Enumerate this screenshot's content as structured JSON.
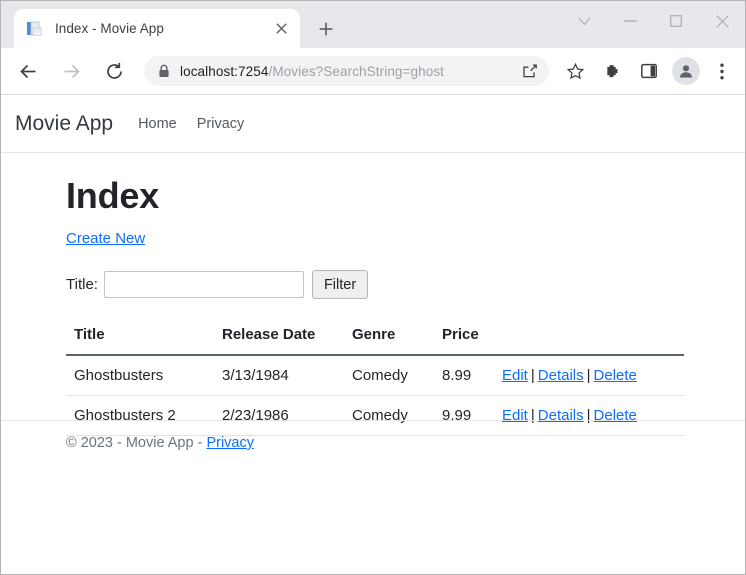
{
  "browser": {
    "tab": {
      "title": "Index - Movie App",
      "favicon": "document-icon",
      "close_label": "×"
    },
    "new_tab_label": "+",
    "window_controls": {
      "tab_search": "tab-search-icon",
      "minimize": "minimize-icon",
      "maximize": "maximize-icon",
      "close": "close-icon"
    },
    "nav": {
      "back": "back-icon",
      "forward": "forward-icon",
      "reload": "reload-icon"
    },
    "omnibox": {
      "security_icon": "lock-icon",
      "url_host": "localhost:7254",
      "url_path": "/Movies?SearchString=ghost",
      "full_url": "localhost:7254/Movies?SearchString=ghost",
      "share_icon": "share-icon",
      "bookmark_icon": "star-icon"
    },
    "toolbar_right": {
      "extensions": "puzzle-icon",
      "side_panel": "side-panel-icon",
      "profile": "avatar-icon",
      "menu": "three-dot-menu-icon"
    }
  },
  "site": {
    "brand": "Movie App",
    "nav_links": [
      {
        "label": "Home"
      },
      {
        "label": "Privacy"
      }
    ]
  },
  "main": {
    "heading": "Index",
    "create_new_label": "Create New",
    "filter": {
      "label": "Title:",
      "value": "",
      "placeholder": "",
      "button_label": "Filter"
    },
    "table": {
      "columns": [
        "Title",
        "Release Date",
        "Genre",
        "Price",
        ""
      ],
      "rows": [
        {
          "title": "Ghostbusters",
          "release_date": "3/13/1984",
          "genre": "Comedy",
          "price": "8.99",
          "actions": [
            "Edit",
            "Details",
            "Delete"
          ]
        },
        {
          "title": "Ghostbusters 2",
          "release_date": "2/23/1986",
          "genre": "Comedy",
          "price": "9.99",
          "actions": [
            "Edit",
            "Details",
            "Delete"
          ]
        }
      ],
      "action_separator": "|"
    }
  },
  "footer": {
    "copyright": "© 2023 - Movie App - ",
    "privacy_label": "Privacy"
  },
  "colors": {
    "link": "#0d6efd",
    "tabstrip": "#e7e8ec",
    "omnibox": "#f1f3f4",
    "text": "#212529",
    "muted": "#6c757d"
  }
}
